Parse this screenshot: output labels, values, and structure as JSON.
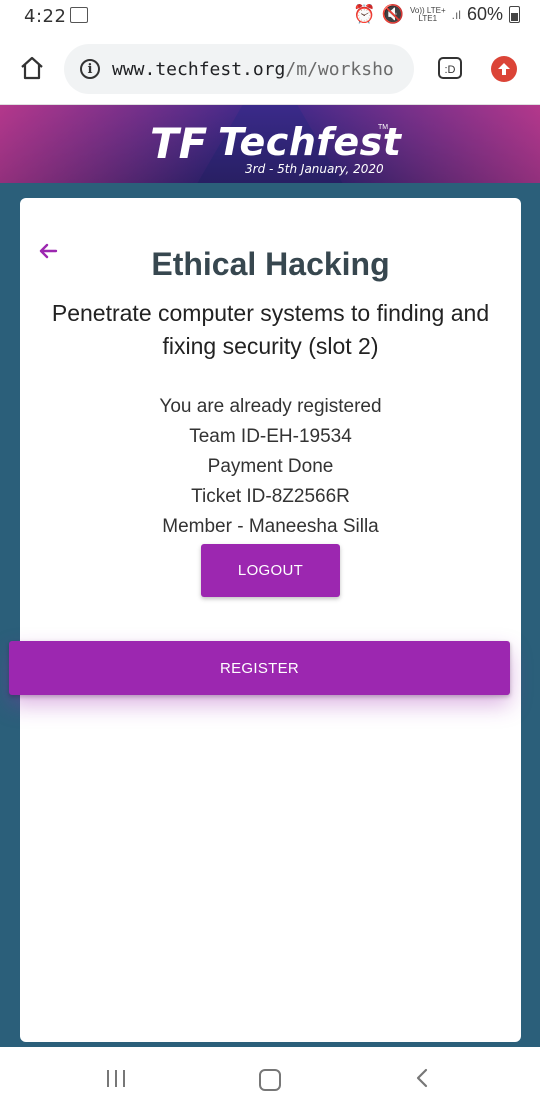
{
  "status_bar": {
    "time": "4:22",
    "network_top": "Vo)) LTE+",
    "network_bottom": "LTE1",
    "battery": "60%"
  },
  "browser": {
    "url_host": "www.techfest.org",
    "url_path": "/m/worksho",
    "tab_label": ":D"
  },
  "banner": {
    "logo_mark": "TF",
    "logo_text": "Techfest",
    "trademark": "TM",
    "dates": "3rd - 5th January, 2020"
  },
  "workshop": {
    "title": "Ethical Hacking",
    "subtitle": "Penetrate computer systems to finding and fixing security (slot 2)",
    "lines": [
      "You are already registered",
      "Team ID-EH-19534",
      "Payment Done",
      "Ticket ID-8Z2566R",
      "Member - Maneesha Silla"
    ],
    "logout_label": "LOGOUT",
    "register_label": "REGISTER"
  },
  "colors": {
    "accent": "#9c27b0",
    "page_background": "#2b5f7a",
    "banner": "#2e2473"
  }
}
